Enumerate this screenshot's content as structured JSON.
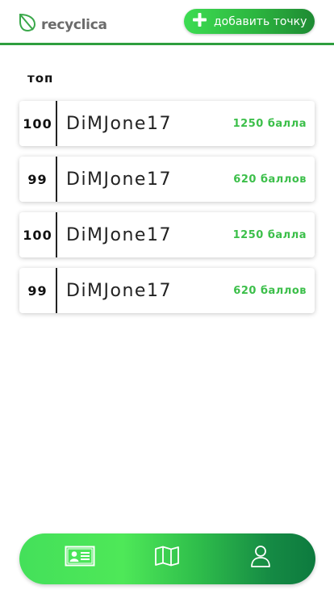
{
  "header": {
    "logo_text": "recyclica",
    "add_button_label": "добавить точку",
    "icons": {
      "logo": "leaf-icon",
      "add": "plus-icon"
    }
  },
  "section": {
    "title": "топ"
  },
  "leaderboard": [
    {
      "rank": "100",
      "name": "DiMJone17",
      "points": "1250 балла"
    },
    {
      "rank": "99",
      "name": "DiMJone17",
      "points": "620 баллов"
    },
    {
      "rank": "100",
      "name": "DiMJone17",
      "points": "1250 балла"
    },
    {
      "rank": "99",
      "name": "DiMJone17",
      "points": "620 баллов"
    }
  ],
  "bottom_nav": {
    "items": [
      {
        "icon": "id-card-icon"
      },
      {
        "icon": "map-icon"
      },
      {
        "icon": "user-icon"
      }
    ]
  },
  "colors": {
    "accent": "#2e9e3e",
    "points_text": "#3cbf4a",
    "logo_text": "#6b6b6b"
  }
}
